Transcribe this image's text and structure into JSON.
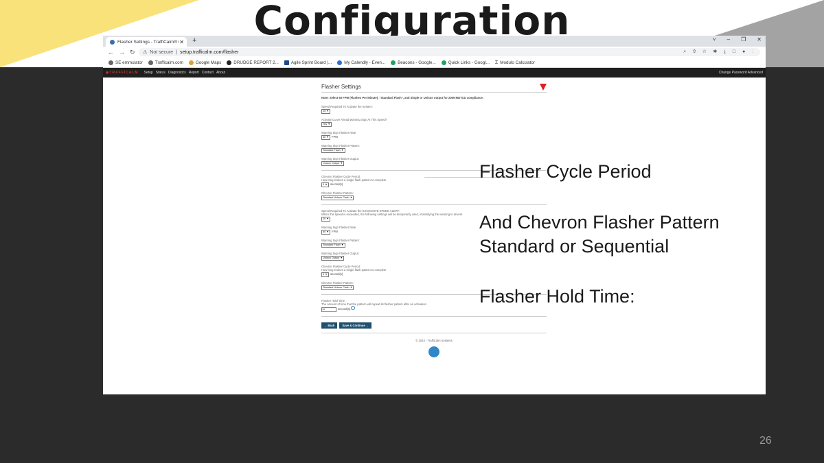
{
  "slide": {
    "title": "Configuration",
    "page_number": "26"
  },
  "browser": {
    "tab_title": "Flasher Settings - TraffiCalm® Cl",
    "tab_close": "✕",
    "new_tab": "+",
    "window_controls": [
      "˅",
      "–",
      "❐",
      "✕"
    ],
    "nav": {
      "back": "←",
      "forward": "→",
      "reload": "↻"
    },
    "address": {
      "security": "⚠",
      "not_secure": "Not secure",
      "separator": "|",
      "url": "setup.trafficalm.com/flasher",
      "right_icons": "⌕ ⇧ ☆ ✱ ⤓ □ ● ⋮"
    },
    "bookmarks": [
      "SE emmulator",
      "Trafficalm.com",
      "Google Maps",
      "DRUDGE REPORT 2...",
      "Agile Sprint Board |...",
      "My Calendly - Even...",
      "Beacons - Google...",
      "Quick Links - Googl...",
      "Modulo Calculator"
    ]
  },
  "site": {
    "logo": "◉TRAFFICALM",
    "nav": [
      "Setup",
      "Status",
      "Diagnostics",
      "Report",
      "Contact",
      "About"
    ],
    "right_links": "Change Password   Advanced"
  },
  "page": {
    "title": "Flasher Settings",
    "note": "Note:  Select 60 FPM (Flashes Per Minute), \"Standard Flash\", and Single or Unison output for 2009 MUTCD compliance.",
    "section1": [
      {
        "label": "Speed Required To Activate the System:",
        "value": "25 ▼"
      },
      {
        "label": "Activate Curve Ahead Warning Sign At This Speed?",
        "value": "Yes ▼"
      },
      {
        "label": "Warning Sign Flasher Rate:",
        "value": "60 ▼",
        "unit": "FPM"
      },
      {
        "label": "Warning Sign Flasher Pattern:",
        "value": "Standard Flash ▼"
      },
      {
        "label": "Warning Sign Flasher Output:",
        "value": "Unison Output ▼"
      }
    ],
    "chevron1": [
      {
        "label": "Chevron Flasher Cycle Period:",
        "sub": "How long it takes a single flash pattern to complete",
        "value": "3 ▼",
        "unit": "second(s)"
      },
      {
        "label": "Chevron Flasher Pattern:",
        "value": "Standard Unison Flash ▼"
      }
    ],
    "alert_label": "Speed Required To Activate the EXCESSIVE SPEED ALERT:",
    "alert_sub": "When this speed is exceeded, the following settings will be temporarily used, intensifying the warning to drivers",
    "alert_value": "20 ▼",
    "section2": [
      {
        "label": "Warning Sign Flasher Rate:",
        "value": "60 ▼",
        "unit": "FPM"
      },
      {
        "label": "Warning Sign Flasher Pattern:",
        "value": "Standard Flash ▼"
      },
      {
        "label": "Warning Sign Flasher Output:",
        "value": "Unison Output ▼"
      }
    ],
    "chevron2": [
      {
        "label": "Chevron Flasher Cycle Period:",
        "sub": "How long it takes a single flash pattern to complete",
        "value": "3 ▼",
        "unit": "second(s)"
      },
      {
        "label": "Chevron Flasher Pattern:",
        "value": "Standard Unison Flash ▼"
      }
    ],
    "hold_label": "Flasher Hold Time:",
    "hold_sub": "The amount of time that the pattern will repeat its flasher pattern after an activation",
    "hold_value": "10",
    "hold_unit": "second(s)",
    "back_button": "← Back",
    "save_button": "Save & Continue →",
    "footer": "© 2023 - TraffiCalm Systems"
  },
  "callouts": {
    "c1": "Flasher Cycle Period",
    "c2a": "And Chevron Flasher Pattern",
    "c2b": "Standard or Sequential",
    "c3": "Flasher Hold Time:"
  }
}
